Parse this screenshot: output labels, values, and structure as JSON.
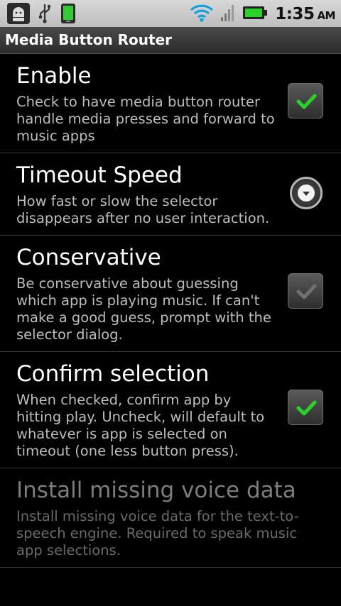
{
  "status_bar": {
    "icons_left": [
      "android-debug-icon",
      "usb-icon",
      "battery-phone-icon"
    ],
    "icons_right": [
      "wifi-icon",
      "signal-icon",
      "battery-icon"
    ],
    "time": "1:35",
    "ampm": "AM",
    "colors": {
      "accent_green": "#2ad12a"
    }
  },
  "app": {
    "title": "Media Button Router"
  },
  "preferences": [
    {
      "title": "Enable",
      "summary": "Check to have media button router handle media presses and forward to music apps",
      "control": "checkbox",
      "checked": true
    },
    {
      "title": "Timeout Speed",
      "summary": "How fast or slow the selector disappears after no user interaction.",
      "control": "dropdown"
    },
    {
      "title": "Conservative",
      "summary": "Be conservative about guessing which app is playing music. If can't make a good guess, prompt with the selector dialog.",
      "control": "checkbox",
      "checked": false
    },
    {
      "title": "Confirm selection",
      "summary": "When checked, confirm app by hitting play. Uncheck, will default to whatever is app is selected on timeout (one less button press).",
      "control": "checkbox",
      "checked": true
    },
    {
      "title": "Install missing voice data",
      "summary": "Install missing voice data for the text-to-speech engine. Required to speak music app selections.",
      "control": "none",
      "enabled": false
    }
  ]
}
